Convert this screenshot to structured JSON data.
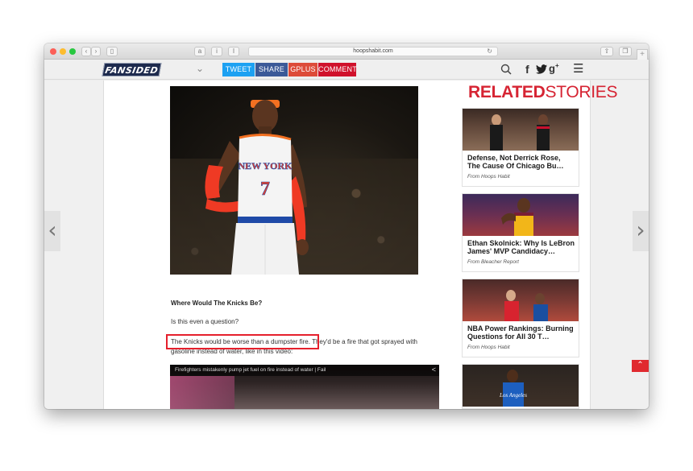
{
  "browser": {
    "url": "hoopshabit.com",
    "amazon_icon": "a",
    "info_icon": "i",
    "reader_icon": "I",
    "reload_icon": "↻"
  },
  "header": {
    "logo": "FANSIDED",
    "share_buttons": [
      {
        "label": "TWEET",
        "color": "#1da1f2"
      },
      {
        "label": "SHARE",
        "color": "#3b5998"
      },
      {
        "label": "GPLUS",
        "color": "#dd4b39"
      },
      {
        "label": "COMMENT",
        "color": "#d0112b"
      }
    ],
    "icons": [
      "search-icon",
      "facebook-icon",
      "twitter-icon",
      "google-plus-icon",
      "menu-icon"
    ]
  },
  "article": {
    "hero_jersey_text": "NEW YORK",
    "hero_jersey_number": "7",
    "question": "Where Would The Knicks Be?",
    "para1": "Is this even a question?",
    "para2_highlight": "The Knicks would be worse than a dumpster fire.",
    "para2_rest": " They'd be a fire that got sprayed with gasoline instead of water, like in this video:",
    "video_title": "Firefighters mistakenly pump jet fuel on fire instead of water | Fail"
  },
  "sidebar": {
    "title_bold": "RELATED",
    "title_rest": "STORIES",
    "stories": [
      {
        "title": "Defense, Not Derrick Rose, The Cause Of Chicago Bu…",
        "source": "From Hoops Habit"
      },
      {
        "title": "Ethan Skolnick: Why Is LeBron James' MVP Candidacy…",
        "source": "From Bleacher Report"
      },
      {
        "title": "NBA Power Rankings: Burning Questions for All 30 T…",
        "source": "From Hoops Habit"
      },
      {
        "title": "",
        "source": ""
      }
    ]
  },
  "nav": {
    "prev": "‹",
    "next": "›",
    "scroll_top": "⌃"
  }
}
